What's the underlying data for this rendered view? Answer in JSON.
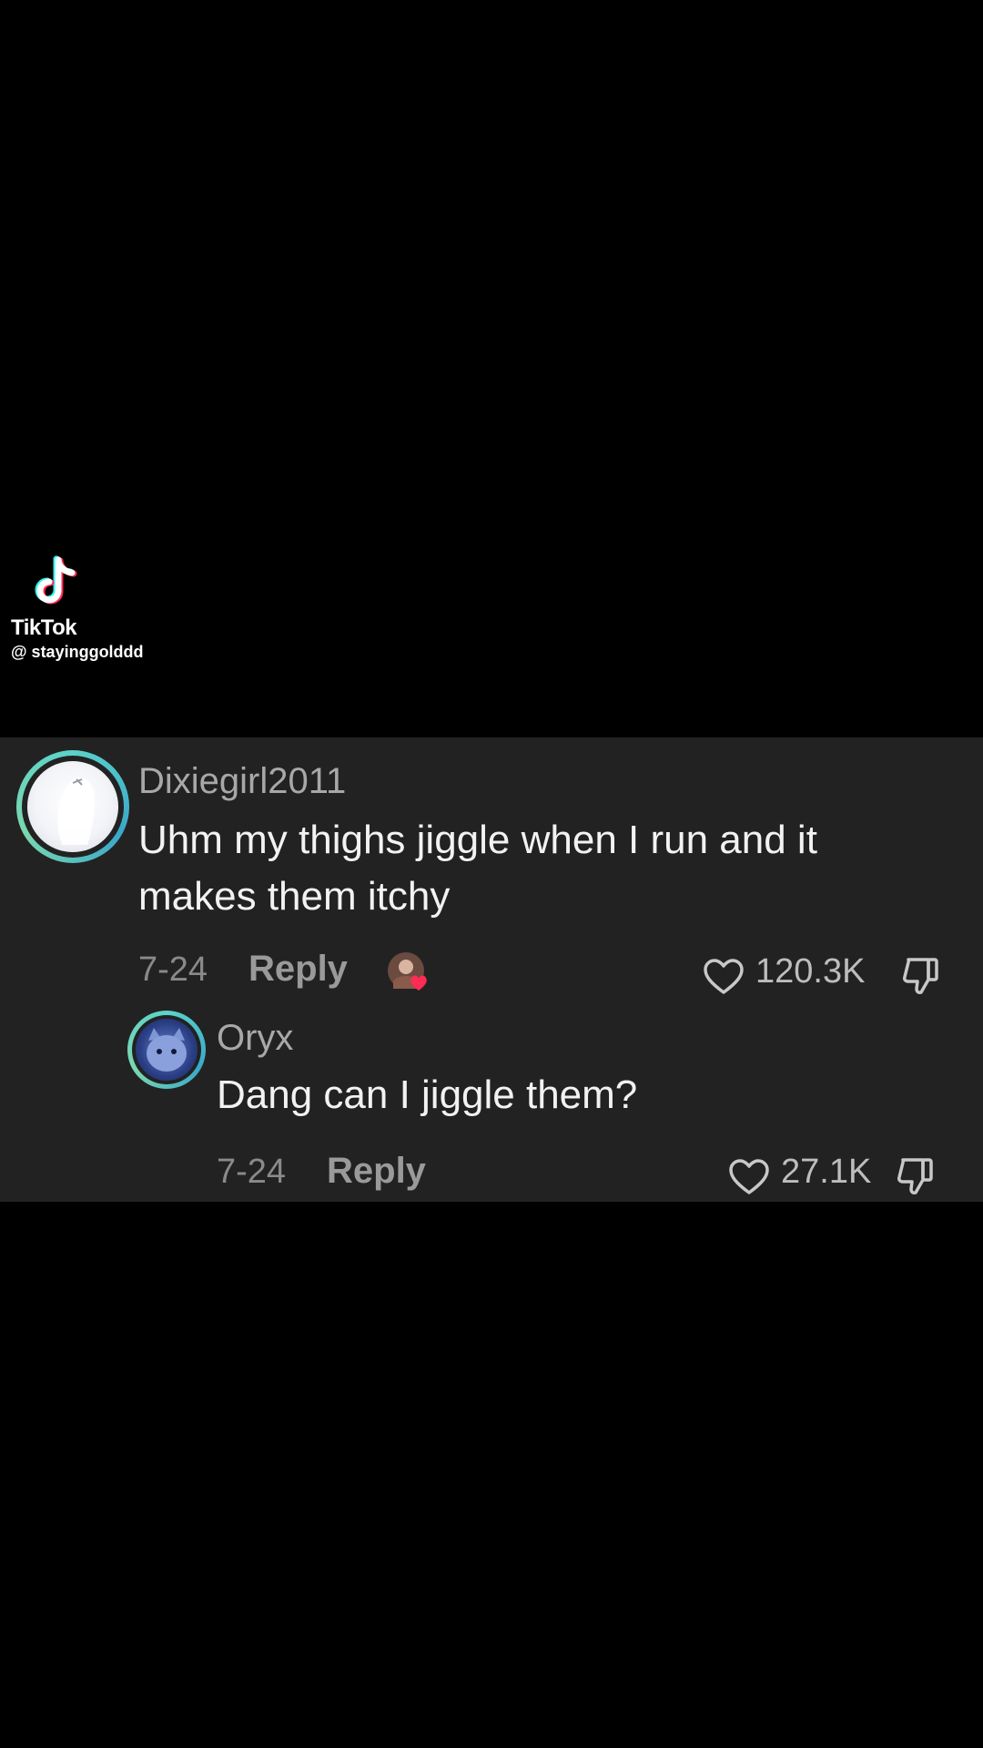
{
  "watermark": {
    "brand": "TikTok",
    "handle": "@ stayinggolddd",
    "logo_icon": "tiktok-logo-icon"
  },
  "colors": {
    "panel_bg": "#222223",
    "avatar_ring": "#5bd3c9",
    "heart_badge": "#fe2c55"
  },
  "comments": [
    {
      "username": "Dixiegirl2011",
      "text": "Uhm my thighs jiggle when I run and it makes them itchy",
      "date": "7-24",
      "reply_label": "Reply",
      "likes": "120.3K",
      "liked_by_creator": true
    },
    {
      "username": "Oryx",
      "text": "Dang can I jiggle them?",
      "date": "7-24",
      "reply_label": "Reply",
      "likes": "27.1K"
    }
  ]
}
